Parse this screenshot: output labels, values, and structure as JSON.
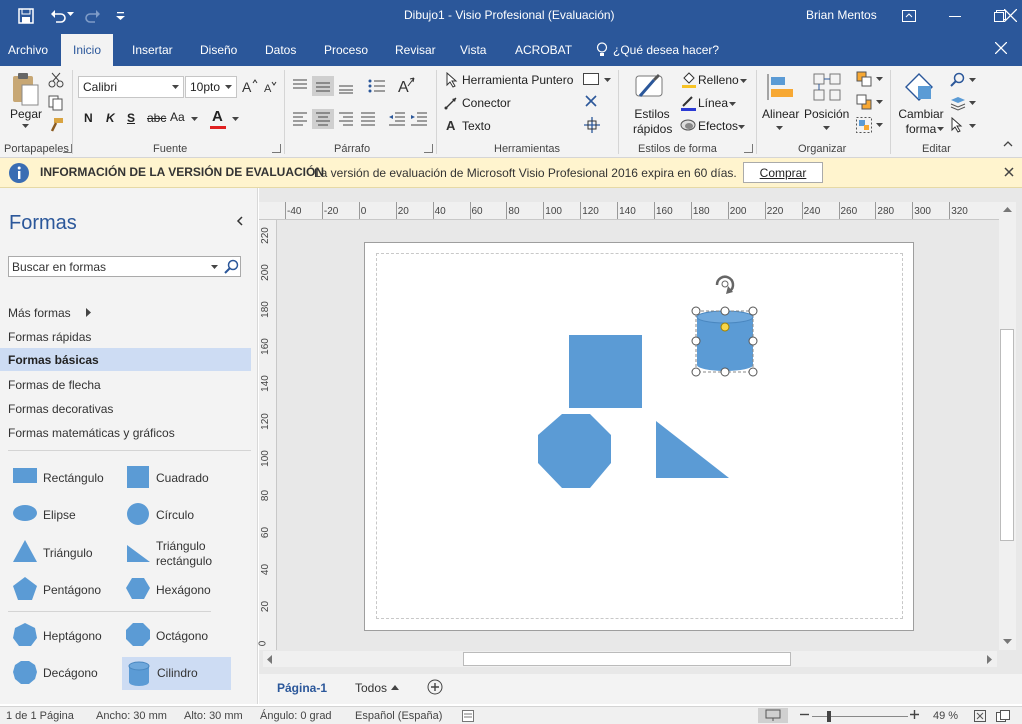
{
  "titlebar": {
    "title": "Dibujo1  -  Visio Profesional (Evaluación)",
    "user": "Brian Mentos"
  },
  "tabs": [
    "Archivo",
    "Inicio",
    "Insertar",
    "Diseño",
    "Datos",
    "Proceso",
    "Revisar",
    "Vista",
    "ACROBAT"
  ],
  "tell_me": "¿Qué desea hacer?",
  "ribbon": {
    "paste": "Pegar",
    "font_name": "Calibri",
    "font_size": "10pto",
    "bold": "N",
    "italic": "K",
    "underline": "S",
    "strike": "abc",
    "case": "Aa",
    "font_color_letter": "A",
    "pointer": "Herramienta Puntero",
    "connector": "Conector",
    "text": "Texto",
    "quick_styles": "Estilos rápidos",
    "fill": "Relleno",
    "line": "Línea",
    "effects": "Efectos",
    "align": "Alinear",
    "position": "Posición",
    "change_shape": "Cambiar forma",
    "groups": [
      "Portapapeles",
      "Fuente",
      "Párrafo",
      "Herramientas",
      "Estilos de forma",
      "Organizar",
      "Editar"
    ]
  },
  "infobar": {
    "title": "INFORMACIÓN DE LA VERSIÓN DE EVALUACIÓN",
    "message": "La versión de evaluación de Microsoft Visio Profesional 2016 expira en 60 días.",
    "button": "Comprar"
  },
  "shapes_pane": {
    "title": "Formas",
    "search_placeholder": "Buscar en formas",
    "more": "Más formas",
    "stencils": [
      "Formas rápidas",
      "Formas básicas",
      "Formas de flecha",
      "Formas decorativas",
      "Formas matemáticas y gráficos"
    ],
    "selected_stencil": "Formas básicas",
    "shapes": [
      "Rectángulo",
      "Cuadrado",
      "Elipse",
      "Círculo",
      "Triángulo",
      "Triángulo rectángulo",
      "Pentágono",
      "Hexágono",
      "Heptágono",
      "Octágono",
      "Decágono",
      "Cilindro"
    ],
    "selected_shape": "Cilindro"
  },
  "rulers": {
    "h": [
      "-40",
      "-20",
      "0",
      "20",
      "40",
      "60",
      "80",
      "100",
      "120",
      "140",
      "160",
      "180",
      "200",
      "220",
      "240",
      "260",
      "280",
      "300",
      "320"
    ],
    "v": [
      "220",
      "200",
      "180",
      "160",
      "140",
      "120",
      "100",
      "80",
      "60",
      "40",
      "20",
      "0"
    ]
  },
  "pages": {
    "current": "Página-1",
    "all": "Todos"
  },
  "status": {
    "page": "1 de 1 Página",
    "width": "Ancho: 30 mm",
    "height": "Alto: 30 mm",
    "angle": "Ángulo: 0 grad",
    "language": "Español (España)",
    "zoom": "49 %"
  },
  "colors": {
    "accent": "#2b579a",
    "shape_fill": "#5b9bd5",
    "infobar": "#fff4ce"
  }
}
